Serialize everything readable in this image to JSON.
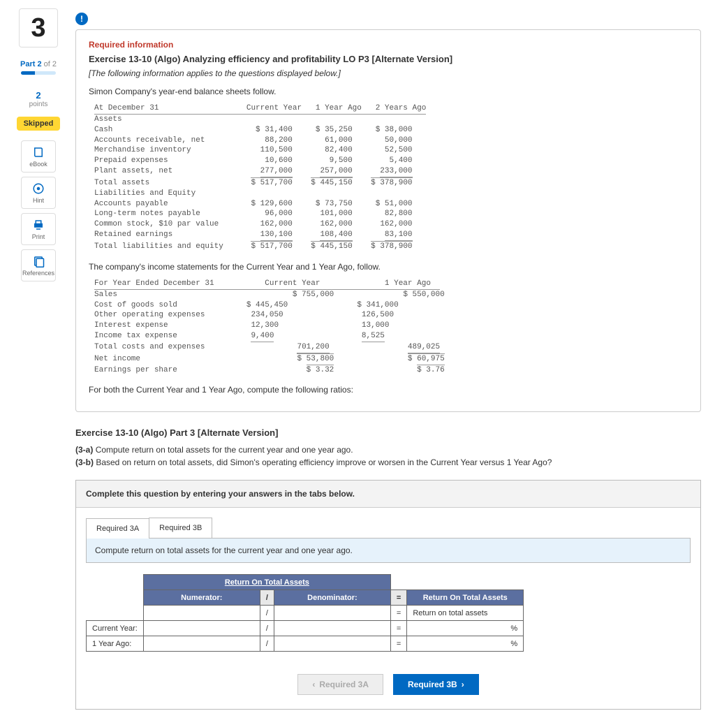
{
  "left": {
    "question_number": "3",
    "part_label_prefix": "Part 2",
    "part_label_of": "of 2",
    "points_value": "2",
    "points_label": "points",
    "skipped": "Skipped",
    "side_buttons": {
      "ebook": "eBook",
      "hint": "Hint",
      "print": "Print",
      "references": "References"
    }
  },
  "header": {
    "required_info": "Required information",
    "exercise_title": "Exercise 13-10 (Algo) Analyzing efficiency and profitability LO P3 [Alternate Version]",
    "preface_italic": "[The following information applies to the questions displayed below.]",
    "intro": "Simon Company's year-end balance sheets follow."
  },
  "balance_sheet": {
    "col_labels": {
      "date": "At December 31",
      "c1": "Current Year",
      "c2": "1 Year Ago",
      "c3": "2 Years Ago"
    },
    "assets_label": "Assets",
    "rows": [
      {
        "label": "Cash",
        "c1": "$ 31,400",
        "c2": "$ 35,250",
        "c3": "$ 38,000"
      },
      {
        "label": "Accounts receivable, net",
        "c1": "88,200",
        "c2": "61,000",
        "c3": "50,000"
      },
      {
        "label": "Merchandise inventory",
        "c1": "110,500",
        "c2": "82,400",
        "c3": "52,500"
      },
      {
        "label": "Prepaid expenses",
        "c1": "10,600",
        "c2": "9,500",
        "c3": "5,400"
      },
      {
        "label": "Plant assets, net",
        "c1": "277,000",
        "c2": "257,000",
        "c3": "233,000"
      }
    ],
    "total_assets": {
      "label": "Total assets",
      "c1": "$ 517,700",
      "c2": "$ 445,150",
      "c3": "$ 378,900"
    },
    "liab_label": "Liabilities and Equity",
    "liab_rows": [
      {
        "label": "Accounts payable",
        "c1": "$ 129,600",
        "c2": "$ 73,750",
        "c3": "$ 51,000"
      },
      {
        "label": "Long-term notes payable",
        "c1": "96,000",
        "c2": "101,000",
        "c3": "82,800"
      },
      {
        "label": "Common stock, $10 par value",
        "c1": "162,000",
        "c2": "162,000",
        "c3": "162,000"
      },
      {
        "label": "Retained earnings",
        "c1": "130,100",
        "c2": "108,400",
        "c3": "83,100"
      }
    ],
    "total_liab": {
      "label": "Total liabilities and equity",
      "c1": "$ 517,700",
      "c2": "$ 445,150",
      "c3": "$ 378,900"
    }
  },
  "income_intro": "The company's income statements for the Current Year and 1 Year Ago, follow.",
  "income": {
    "col_labels": {
      "date": "For Year Ended December 31",
      "c1": "Current Year",
      "c2": "1 Year Ago"
    },
    "sales": {
      "label": "Sales",
      "c1": "$ 755,000",
      "c2": "$ 550,000"
    },
    "rows": [
      {
        "label": "Cost of goods sold",
        "c1_a": "$ 445,450",
        "c2_a": "$ 341,000"
      },
      {
        "label": "Other operating expenses",
        "c1_a": "234,050",
        "c2_a": "126,500"
      },
      {
        "label": "Interest expense",
        "c1_a": "12,300",
        "c2_a": "13,000"
      },
      {
        "label": "Income tax expense",
        "c1_a": "9,400",
        "c2_a": "8,525"
      }
    ],
    "total_costs": {
      "label": "Total costs and expenses",
      "c1": "701,200",
      "c2": "489,025"
    },
    "net_income": {
      "label": "Net income",
      "c1": "$ 53,800",
      "c2": "$ 60,975"
    },
    "eps": {
      "label": "Earnings per share",
      "c1": "$ 3.32",
      "c2": "$ 3.76"
    }
  },
  "ratios_instr": "For both the Current Year and 1 Year Ago, compute the following ratios:",
  "part3": {
    "title": "Exercise 13-10 (Algo) Part 3 [Alternate Version]",
    "line_a": "(3-a) Compute return on total assets for the current year and one year ago.",
    "line_b": "(3-b) Based on return on total assets, did Simon's operating efficiency improve or worsen in the Current Year versus 1 Year Ago?"
  },
  "answer": {
    "header": "Complete this question by entering your answers in the tabs below.",
    "tab_a": "Required 3A",
    "tab_b": "Required 3B",
    "sub_instr": "Compute return on total assets for the current year and one year ago.",
    "table": {
      "main_header": "Return On Total Assets",
      "numerator": "Numerator:",
      "slash": "/",
      "denominator": "Denominator:",
      "equals": "=",
      "result_header": "Return On Total Assets",
      "result_row1": "Return on total assets",
      "row_cy": "Current Year:",
      "row_py": "1 Year Ago:",
      "pct": "%"
    },
    "nav_prev": "Required 3A",
    "nav_next": "Required 3B"
  }
}
